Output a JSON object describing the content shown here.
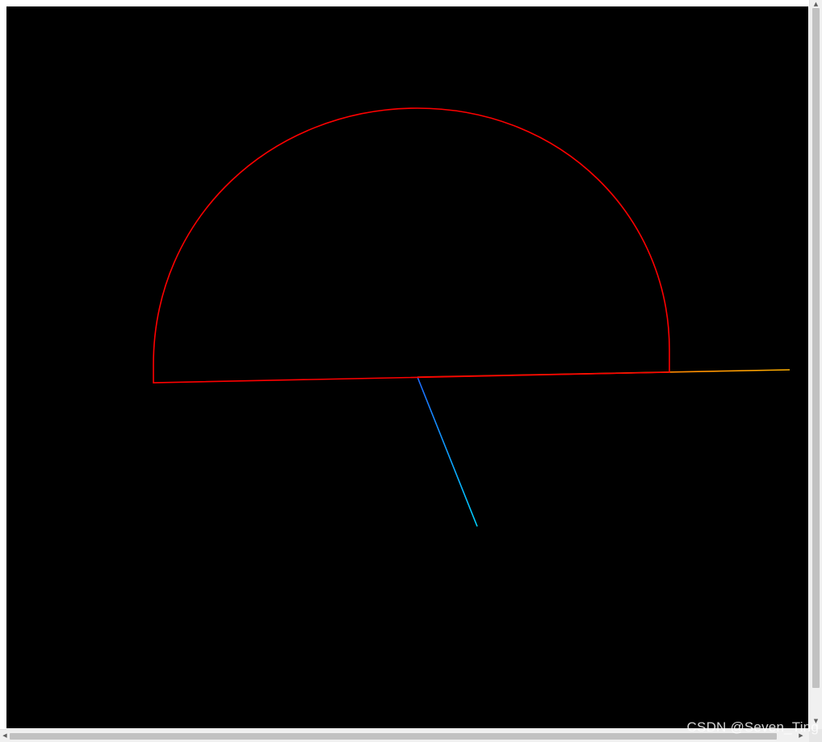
{
  "scene": {
    "background": "#000000",
    "colors": {
      "semicircle": "#ff0000",
      "x_axis": "#ffa500",
      "y_axis_top": "#ffff00",
      "y_axis_base": "#00ff00",
      "z_axis": "#00bfff"
    }
  },
  "scrollbars": {
    "vertical": {
      "up_glyph": "▲",
      "down_glyph": "▼"
    },
    "horizontal": {
      "left_glyph": "◀",
      "right_glyph": "▶"
    }
  },
  "watermark": {
    "text": "CSDN @Seven_Ting"
  }
}
